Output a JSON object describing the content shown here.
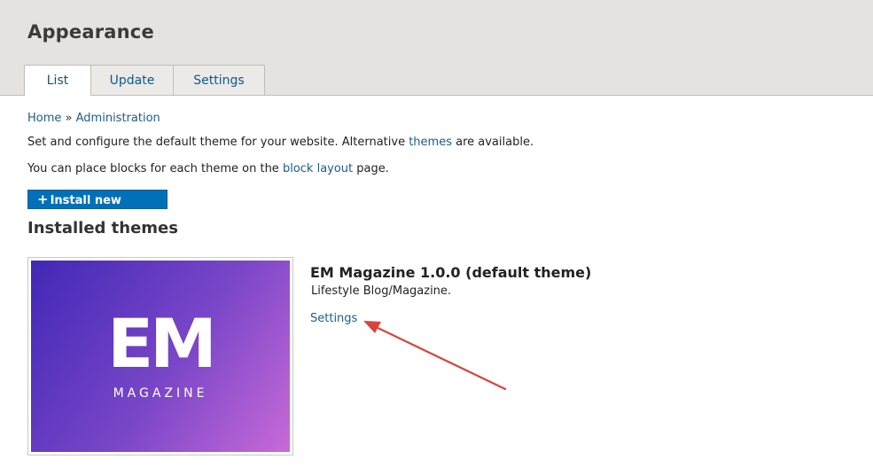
{
  "header": {
    "title": "Appearance",
    "tabs": [
      {
        "label": "List",
        "active": true
      },
      {
        "label": "Update",
        "active": false
      },
      {
        "label": "Settings",
        "active": false
      }
    ]
  },
  "breadcrumb": {
    "home": "Home",
    "separator": "»",
    "admin": "Administration"
  },
  "intro": {
    "line1_before": "Set and configure the default theme for your website. Alternative ",
    "line1_link": "themes",
    "line1_after": " are available.",
    "line2_before": "You can place blocks for each theme on the ",
    "line2_link": "block layout",
    "line2_after": " page."
  },
  "install_button": {
    "icon": "+",
    "label": "Install new theme"
  },
  "installed": {
    "heading": "Installed themes",
    "theme": {
      "logo_main": "EM",
      "logo_sub": "MAGAZINE",
      "name": "EM Magazine 1.0.0 (default theme)",
      "description": "Lifestyle Blog/Magazine.",
      "settings_link": "Settings"
    }
  },
  "colors": {
    "link": "#1a5c8c",
    "button": "#0071b8",
    "header_bg": "#e5e3df",
    "annotation_arrow": "#d9443b"
  }
}
